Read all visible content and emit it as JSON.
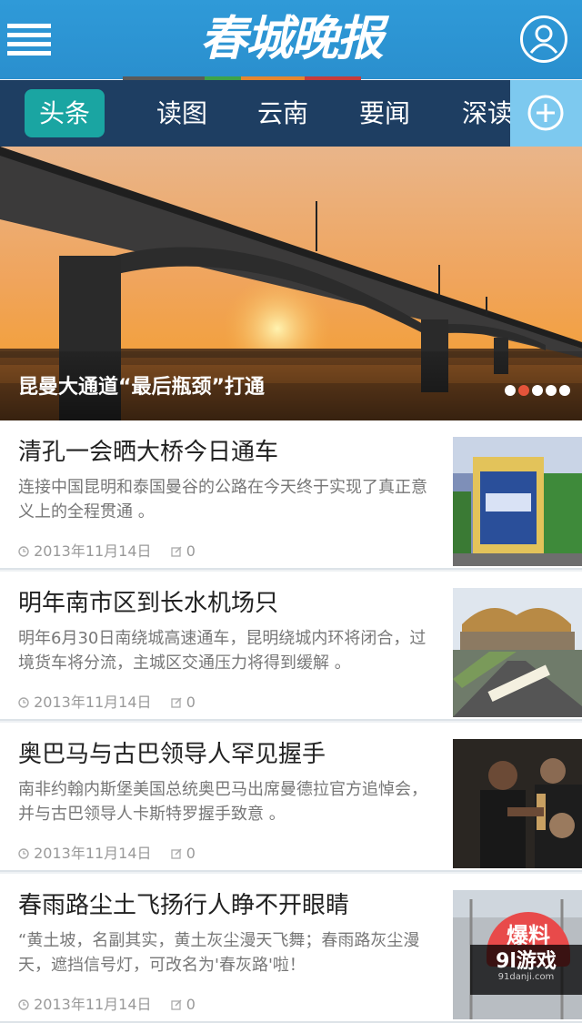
{
  "header": {
    "logo_text": "春城晚报",
    "brand_color": "#2f9ad8",
    "strip_colors": [
      "#5a5a5a",
      "#3da34a",
      "#e4862f",
      "#c63b3b"
    ]
  },
  "tabs": [
    {
      "label": "头条",
      "active": true
    },
    {
      "label": "读图",
      "active": false
    },
    {
      "label": "云南",
      "active": false
    },
    {
      "label": "要闻",
      "active": false
    },
    {
      "label": "深读",
      "active": false
    }
  ],
  "banner": {
    "title": "昆曼大通道“最后瓶颈”打通",
    "slide_count": 5,
    "active_slide": 2
  },
  "news": [
    {
      "title": "清孔一会晒大桥今日通车",
      "summary": "连接中国昆明和泰国曼谷的公路在今天终于实现了真正意义上的全程贯通 。",
      "date": "2013年11月14日",
      "comments": "0"
    },
    {
      "title": "明年南市区到长水机场只",
      "summary": "明年6月30日南绕城高速通车，昆明绕城内环将闭合，过境货车将分流，主城区交通压力将得到缓解 。",
      "date": "2013年11月14日",
      "comments": "0"
    },
    {
      "title": "奥巴马与古巴领导人罕见握手",
      "summary": "南非约翰内斯堡美国总统奥巴马出席曼德拉官方追悼会，并与古巴领导人卡斯特罗握手致意 。",
      "date": "2013年11月14日",
      "comments": "0"
    },
    {
      "title": "春雨路尘土飞扬行人睁不开眼睛",
      "summary": "“黄土坡，名副其实，黄土灰尘漫天飞舞；春雨路灰尘漫天，遮挡信号灯，可改名为'春灰路'啦！",
      "date": "2013年11月14日",
      "comments": "0"
    }
  ],
  "badge": {
    "label": "爆料"
  },
  "watermark": {
    "main": "9l游戏",
    "sub": "91danji.com"
  }
}
